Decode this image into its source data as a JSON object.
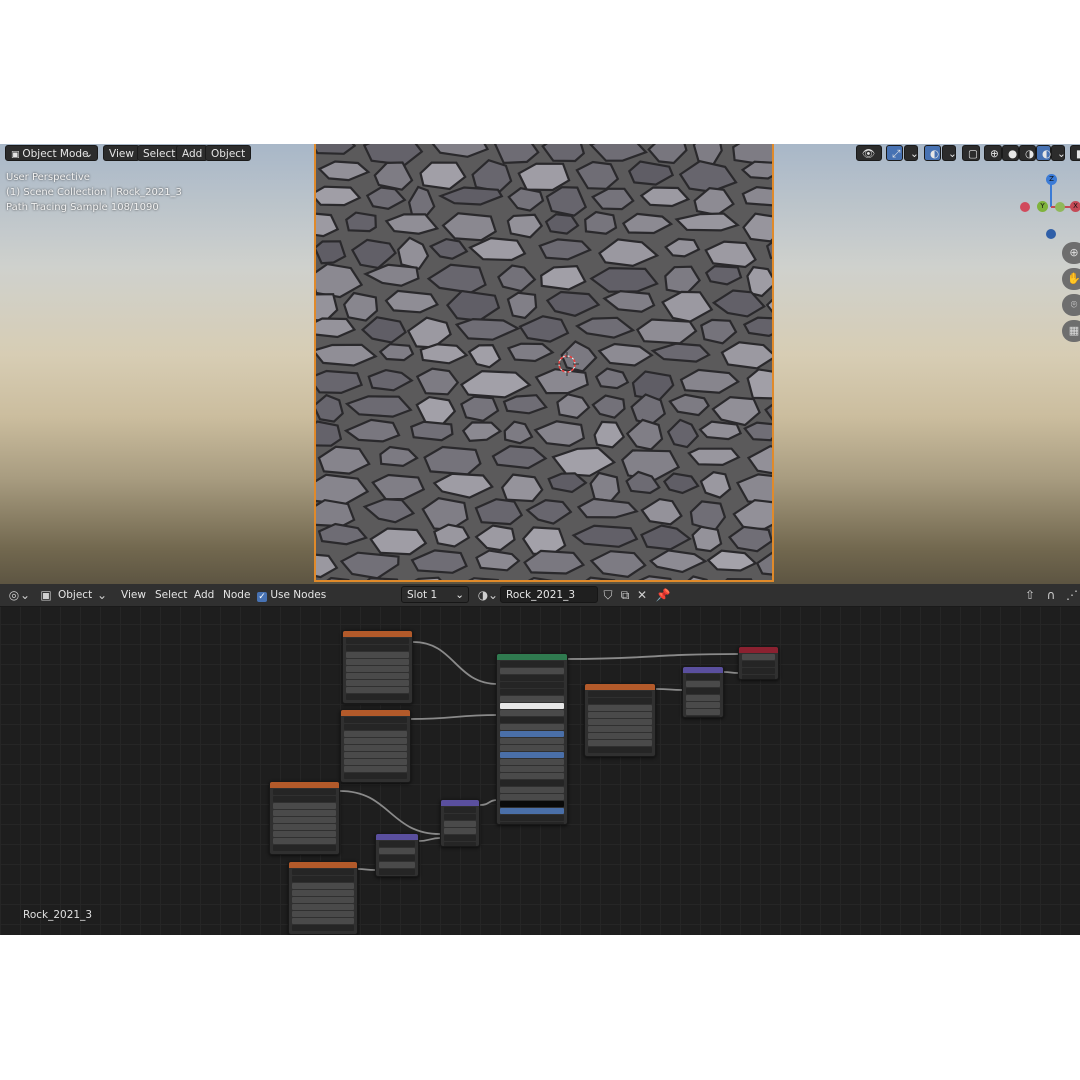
{
  "viewport": {
    "mode_label": "Object Mode",
    "menus": [
      "View",
      "Select",
      "Add",
      "Object"
    ],
    "overlay": {
      "line1": "User Perspective",
      "line2": "(1) Scene Collection | Rock_2021_3",
      "line3": "Path Tracing Sample 108/1090"
    },
    "gizmo": {
      "z": "Z",
      "y": "Y",
      "x": "X"
    }
  },
  "node_editor": {
    "editor_type": "Object",
    "menus": [
      "View",
      "Select",
      "Add",
      "Node"
    ],
    "use_nodes_label": "Use Nodes",
    "use_nodes_checked": true,
    "slot_label": "Slot 1",
    "material_name": "Rock_2021_3",
    "footer_material": "Rock_2021_3"
  },
  "colors": {
    "selection_outline": "#e08a2a",
    "texture_node_header": "#b35a2a",
    "shader_node_header": "#2f7a4f",
    "vector_node_header": "#5a4f9e",
    "output_node_header": "#8a2130",
    "active_blue": "#4772b3"
  }
}
